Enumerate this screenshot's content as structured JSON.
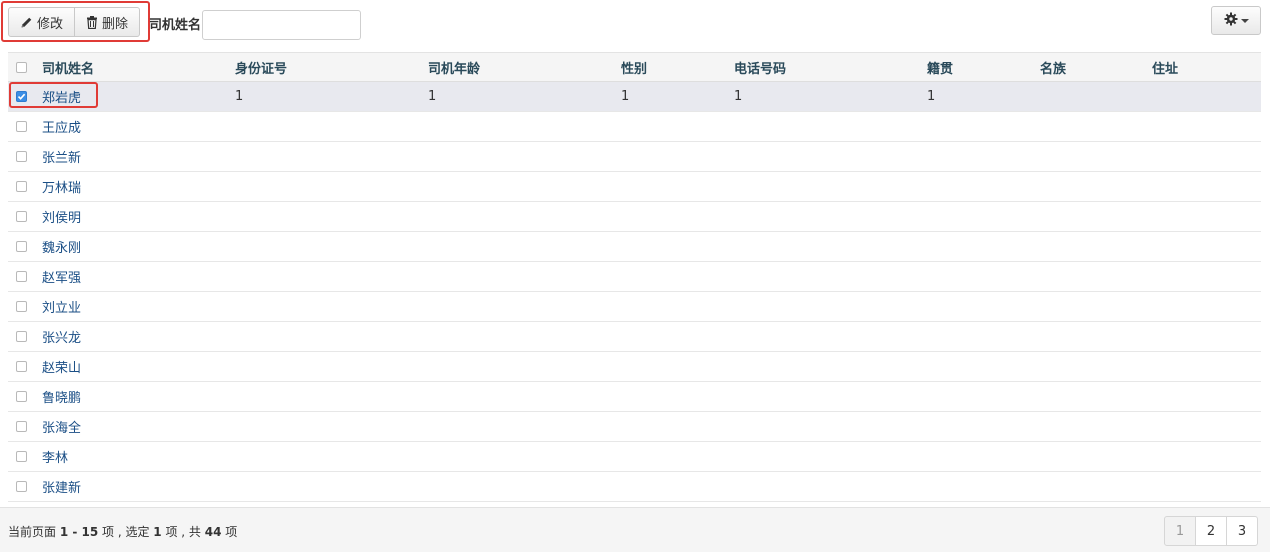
{
  "toolbar": {
    "edit_label": "修改",
    "delete_label": "删除",
    "search_label": "司机姓名",
    "search_value": "",
    "search_placeholder": ""
  },
  "table": {
    "columns": [
      "司机姓名",
      "身份证号",
      "司机年龄",
      "性别",
      "电话号码",
      "籍贯",
      "名族",
      "住址"
    ],
    "rows": [
      {
        "name": "郑岩虎",
        "id_no": "1",
        "age": "1",
        "gender": "1",
        "phone": "1",
        "origin": "1",
        "ethnicity": "",
        "address": "",
        "checked": true
      },
      {
        "name": "王应成",
        "id_no": "",
        "age": "",
        "gender": "",
        "phone": "",
        "origin": "",
        "ethnicity": "",
        "address": "",
        "checked": false
      },
      {
        "name": "张兰新",
        "id_no": "",
        "age": "",
        "gender": "",
        "phone": "",
        "origin": "",
        "ethnicity": "",
        "address": "",
        "checked": false
      },
      {
        "name": "万林瑞",
        "id_no": "",
        "age": "",
        "gender": "",
        "phone": "",
        "origin": "",
        "ethnicity": "",
        "address": "",
        "checked": false
      },
      {
        "name": "刘侯明",
        "id_no": "",
        "age": "",
        "gender": "",
        "phone": "",
        "origin": "",
        "ethnicity": "",
        "address": "",
        "checked": false
      },
      {
        "name": "魏永刚",
        "id_no": "",
        "age": "",
        "gender": "",
        "phone": "",
        "origin": "",
        "ethnicity": "",
        "address": "",
        "checked": false
      },
      {
        "name": "赵军强",
        "id_no": "",
        "age": "",
        "gender": "",
        "phone": "",
        "origin": "",
        "ethnicity": "",
        "address": "",
        "checked": false
      },
      {
        "name": "刘立业",
        "id_no": "",
        "age": "",
        "gender": "",
        "phone": "",
        "origin": "",
        "ethnicity": "",
        "address": "",
        "checked": false
      },
      {
        "name": "张兴龙",
        "id_no": "",
        "age": "",
        "gender": "",
        "phone": "",
        "origin": "",
        "ethnicity": "",
        "address": "",
        "checked": false
      },
      {
        "name": "赵荣山",
        "id_no": "",
        "age": "",
        "gender": "",
        "phone": "",
        "origin": "",
        "ethnicity": "",
        "address": "",
        "checked": false
      },
      {
        "name": "鲁晓鹏",
        "id_no": "",
        "age": "",
        "gender": "",
        "phone": "",
        "origin": "",
        "ethnicity": "",
        "address": "",
        "checked": false
      },
      {
        "name": "张海全",
        "id_no": "",
        "age": "",
        "gender": "",
        "phone": "",
        "origin": "",
        "ethnicity": "",
        "address": "",
        "checked": false
      },
      {
        "name": "李林",
        "id_no": "",
        "age": "",
        "gender": "",
        "phone": "",
        "origin": "",
        "ethnicity": "",
        "address": "",
        "checked": false
      },
      {
        "name": "张建新",
        "id_no": "",
        "age": "",
        "gender": "",
        "phone": "",
        "origin": "",
        "ethnicity": "",
        "address": "",
        "checked": false
      }
    ]
  },
  "footer": {
    "status_prefix": "当前页面 ",
    "range": "1 - 15",
    "status_mid1": " 项 , 选定 ",
    "selected": "1",
    "status_mid2": " 项 , 共 ",
    "total": "44",
    "status_suffix": " 项",
    "pages": [
      "1",
      "2",
      "3"
    ],
    "active_page": "1"
  },
  "icons": {
    "edit": "pencil-icon",
    "delete": "trash-icon",
    "settings": "gear-icon",
    "dropdown": "caret-down-icon"
  },
  "colors": {
    "highlight": "#e03b36",
    "link": "#1b4f86",
    "checkbox_checked": "#3b8ee5",
    "selected_row": "#e8e9ef"
  }
}
